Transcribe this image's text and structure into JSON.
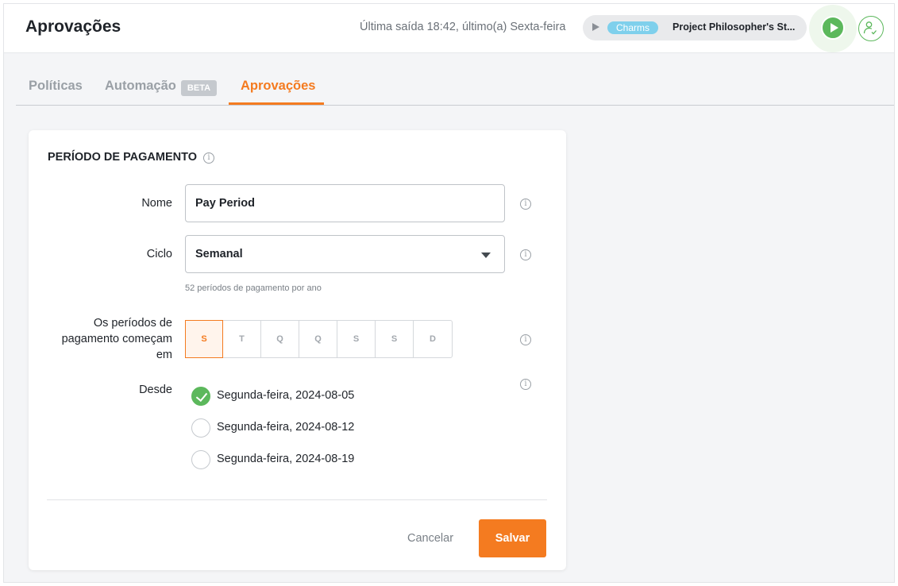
{
  "header": {
    "title": "Aprovações",
    "last_exit": "Última saída 18:42, último(a) Sexta-feira",
    "timer": {
      "tag": "Charms",
      "project": "Project Philosopher's St...",
      "tag_color": "#7fd0ec"
    }
  },
  "tabs": [
    {
      "label": "Políticas",
      "active": false
    },
    {
      "label": "Automação",
      "badge": "BETA",
      "active": false
    },
    {
      "label": "Aprovações",
      "active": true
    }
  ],
  "accent_color": "#f47b20",
  "success_color": "#5cb85c",
  "form": {
    "section_title": "PERÍODO DE PAGAMENTO",
    "info_glyph": "i",
    "name": {
      "label": "Nome",
      "value": "Pay Period"
    },
    "cycle": {
      "label": "Ciclo",
      "value": "Semanal",
      "helper": "52 períodos de pagamento por ano"
    },
    "start_day": {
      "label": "Os períodos de pagamento começam em",
      "days": [
        "S",
        "T",
        "Q",
        "Q",
        "S",
        "S",
        "D"
      ],
      "selected_index": 0
    },
    "since": {
      "label": "Desde",
      "options": [
        {
          "label": "Segunda-feira, 2024-08-05",
          "checked": true
        },
        {
          "label": "Segunda-feira, 2024-08-12",
          "checked": false
        },
        {
          "label": "Segunda-feira, 2024-08-19",
          "checked": false
        }
      ]
    },
    "cancel_label": "Cancelar",
    "save_label": "Salvar"
  }
}
